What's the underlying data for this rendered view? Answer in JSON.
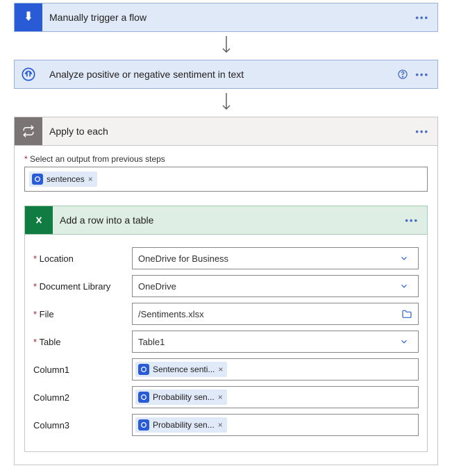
{
  "trigger": {
    "title": "Manually trigger a flow"
  },
  "sentiment": {
    "title": "Analyze positive or negative sentiment in text"
  },
  "loop": {
    "title": "Apply to each",
    "output_label": "Select an output from previous steps",
    "token": "sentences"
  },
  "action": {
    "title": "Add a row into a table",
    "fields": {
      "location_label": "Location",
      "location_value": "OneDrive for Business",
      "library_label": "Document Library",
      "library_value": "OneDrive",
      "file_label": "File",
      "file_value": "/Sentiments.xlsx",
      "table_label": "Table",
      "table_value": "Table1",
      "col1_label": "Column1",
      "col1_token": "Sentence senti...",
      "col2_label": "Column2",
      "col2_token": "Probability sen...",
      "col3_label": "Column3",
      "col3_token": "Probability sen..."
    }
  }
}
